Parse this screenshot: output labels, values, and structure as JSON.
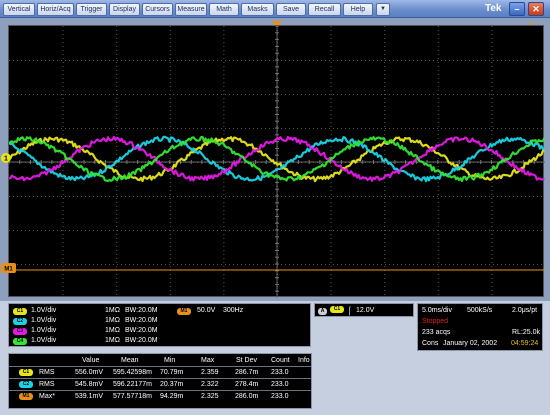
{
  "menu": {
    "items": [
      "Vertical",
      "Horiz/Acq",
      "Trigger",
      "Display",
      "Cursors",
      "Measure",
      "Math",
      "Masks",
      "Save",
      "Recall",
      "Help"
    ],
    "dropdown_glyph": "▼",
    "brand": "Tek",
    "minimize_glyph": "–",
    "close_glyph": "✕"
  },
  "markers": {
    "trigger_glyph": "T",
    "ch1_marker": "1",
    "m1_marker": "M1"
  },
  "channels": [
    {
      "label": "1.0V/div",
      "impedance": "1MΩ",
      "bw": "BW:20.0M",
      "badge": "C1",
      "color": "#e6e619"
    },
    {
      "label": "1.0V/div",
      "impedance": "1MΩ",
      "bw": "BW:20.0M",
      "badge": "C2",
      "color": "#19d4e6"
    },
    {
      "label": "1.0V/div",
      "impedance": "1MΩ",
      "bw": "BW:20.0M",
      "badge": "C3",
      "color": "#e619e6"
    },
    {
      "label": "1.0V/div",
      "impedance": "1MΩ",
      "bw": "BW:20.0M",
      "badge": "C4",
      "color": "#33e633"
    }
  ],
  "math": {
    "badge": "M1",
    "scale": "50.0V",
    "freq": "300Hz",
    "color": "#e69019"
  },
  "trigger": {
    "mode_badge": "A",
    "source_badge": "C1",
    "slope": "⌠",
    "level": "12.0V"
  },
  "timebase": {
    "div": "5.0ms/div",
    "rate": "500kS/s",
    "pt": "2.0μs/pt",
    "state": "Stopped",
    "acqs": "233 acqs",
    "rl": "RL:25.0k",
    "mode": "Cons",
    "date": "January 02, 2002",
    "time": "04:59:24"
  },
  "measurements": {
    "headers": [
      "Value",
      "Mean",
      "Min",
      "Max",
      "St Dev",
      "Count",
      "Info"
    ],
    "rows": [
      {
        "badge": "C1",
        "name": "RMS",
        "value": "556.0mV",
        "mean": "595.42598m",
        "min": "70.79m",
        "max": "2.359",
        "stdev": "286.7m",
        "count": "233.0",
        "info": ""
      },
      {
        "badge": "C2",
        "name": "RMS",
        "value": "545.8mV",
        "mean": "596.22177m",
        "min": "20.37m",
        "max": "2.322",
        "stdev": "278.4m",
        "count": "233.0",
        "info": ""
      },
      {
        "badge": "M1",
        "name": "Max*",
        "value": "539.1mV",
        "mean": "577.57718m",
        "min": "94.29m",
        "max": "2.325",
        "stdev": "286.0m",
        "count": "233.0",
        "info": ""
      }
    ]
  },
  "colors": {
    "ch1": "#e6e619",
    "ch2": "#19d4e6",
    "ch3": "#e619e6",
    "ch4": "#33e633",
    "math": "#e69019",
    "stopped": "#e02020",
    "time": "#e6c019"
  }
}
